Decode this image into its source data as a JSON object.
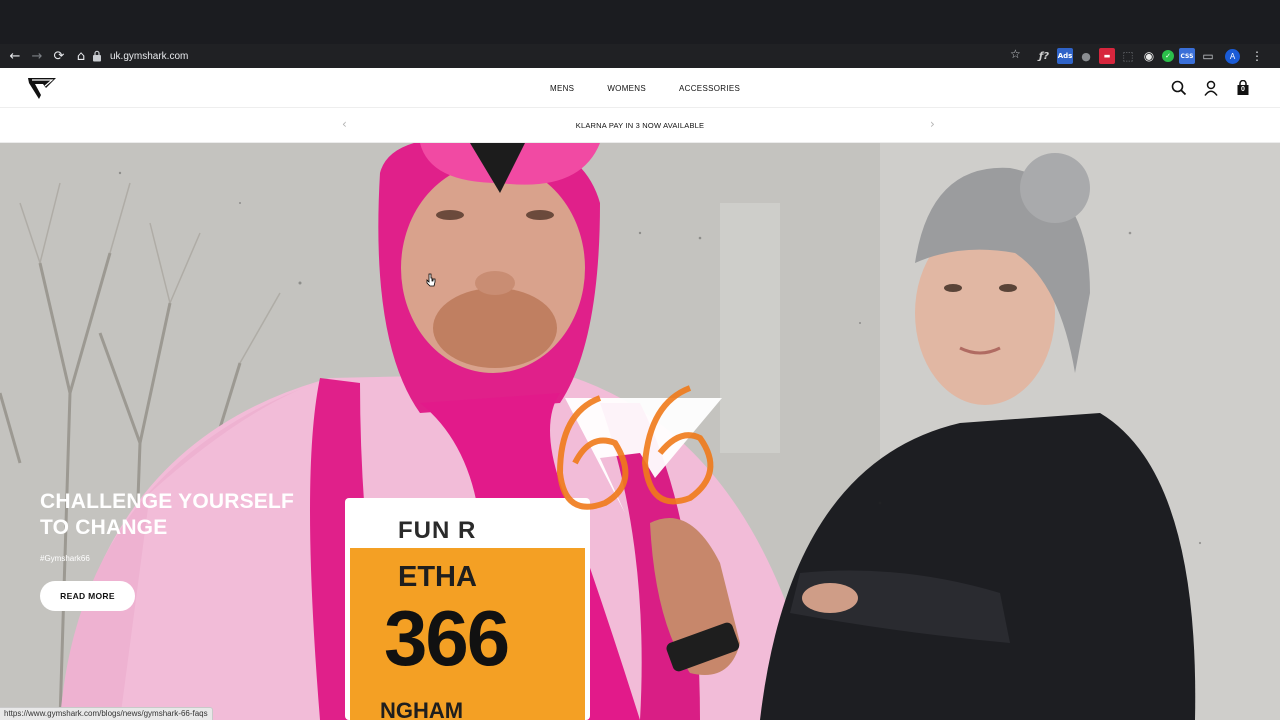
{
  "browser": {
    "url": "uk.gymshark.com",
    "back_icon": "←",
    "forward_icon": "→",
    "reload_icon": "⟳",
    "home_icon": "⌂",
    "star_icon": "☆",
    "menu_icon": "⋮",
    "profile_initial": "A",
    "extensions": [
      {
        "name": "fx-extension-icon",
        "label": "ƒ?",
        "color": "#202124"
      },
      {
        "name": "ads-extension-icon",
        "label": "Ads",
        "color": "#2f63c8"
      },
      {
        "name": "circle-extension-icon",
        "label": "●",
        "color": "#202124"
      },
      {
        "name": "red-extension-icon",
        "label": "▬",
        "color": "#d7263d"
      },
      {
        "name": "dashed-extension-icon",
        "label": "⬚",
        "color": "#202124"
      },
      {
        "name": "white-circle-extension-icon",
        "label": "◉",
        "color": "#202124"
      },
      {
        "name": "check-extension-icon",
        "label": "✓",
        "color": "#2bbf4a"
      },
      {
        "name": "badge-extension-icon",
        "label": "CSS",
        "color": "#3a6fd8"
      },
      {
        "name": "cast-icon",
        "label": "▭",
        "color": "#202124"
      }
    ],
    "status_url": "https://www.gymshark.com/blogs/news/gymshark-66-faqs"
  },
  "header": {
    "nav": [
      "MENS",
      "WOMENS",
      "ACCESSORIES"
    ],
    "cart_count": "0"
  },
  "promo": {
    "text": "KLARNA PAY IN 3 NOW AVAILABLE",
    "prev": "‹",
    "next": "›"
  },
  "hero": {
    "title_line1": "CHALLENGE YOURSELF",
    "title_line2": "TO CHANGE",
    "hashtag": "#Gymshark66",
    "cta": "READ MORE",
    "bib_text_1": "FUN R",
    "bib_text_2": "ETHA",
    "bib_number": "366",
    "bib_text_3": "NGHAM"
  },
  "colors": {
    "brand_orange": "#f07a1a",
    "costume_pink": "#e0208a",
    "shirt_pink": "#f0b8d6"
  }
}
